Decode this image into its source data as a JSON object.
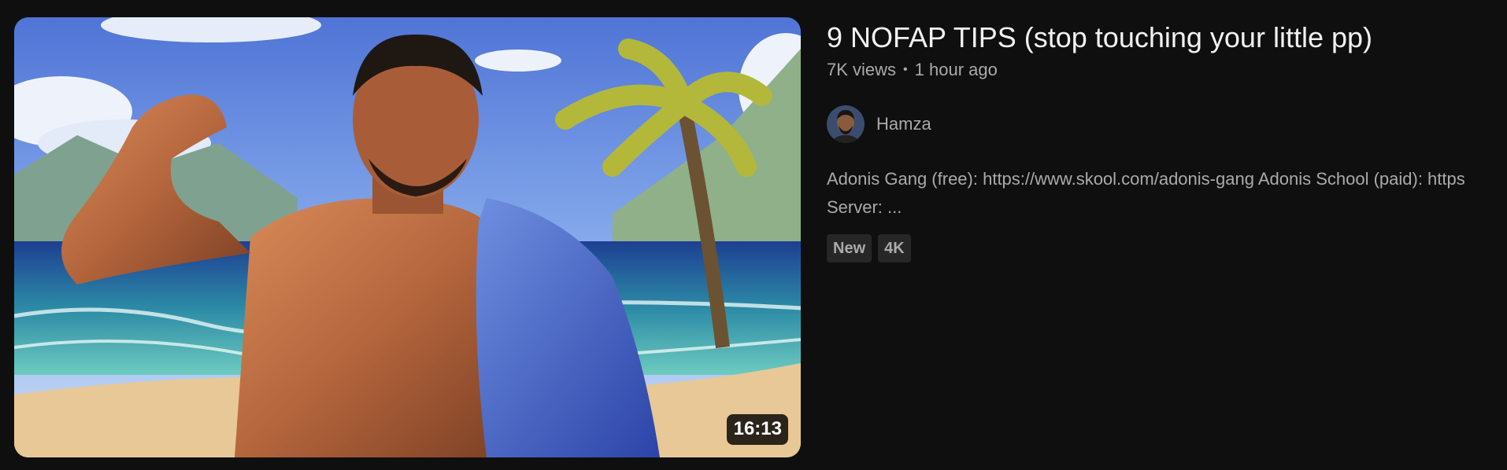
{
  "video": {
    "duration": "16:13",
    "title": "9 NOFAP TIPS (stop touching your little pp)",
    "views": "7K views",
    "separator": "•",
    "age": "1 hour ago",
    "channel": "Hamza",
    "description_line1": "Adonis Gang (free): https://www.skool.com/adonis-gang Adonis School (paid): https",
    "description_line2": "Server: ...",
    "badges": [
      "New",
      "4K"
    ]
  },
  "colors": {
    "background": "#0f0f0f",
    "text_primary": "#f1f1f1",
    "text_secondary": "#aaaaaa",
    "badge_bg": "#272727"
  }
}
